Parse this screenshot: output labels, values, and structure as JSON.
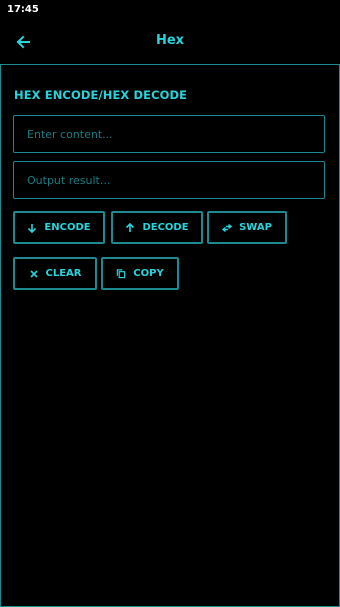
{
  "status_bar": {
    "time": "17:45"
  },
  "app_bar": {
    "title": "Hex"
  },
  "section": {
    "title": "HEX ENCODE/HEX DECODE"
  },
  "input": {
    "placeholder": "Enter content...",
    "value": ""
  },
  "output": {
    "placeholder": "Output result...",
    "value": ""
  },
  "buttons": {
    "encode": "ENCODE",
    "decode": "DECODE",
    "swap": "SWAP",
    "clear": "CLEAR",
    "copy": "COPY"
  },
  "icons": {
    "back": "arrow-left-icon",
    "encode": "arrow-down-icon",
    "decode": "arrow-up-icon",
    "swap": "swap-icon",
    "clear": "close-icon",
    "copy": "copy-icon"
  },
  "colors": {
    "accent": "#2ad3dc",
    "border": "#1c8a90",
    "background": "#000000"
  }
}
